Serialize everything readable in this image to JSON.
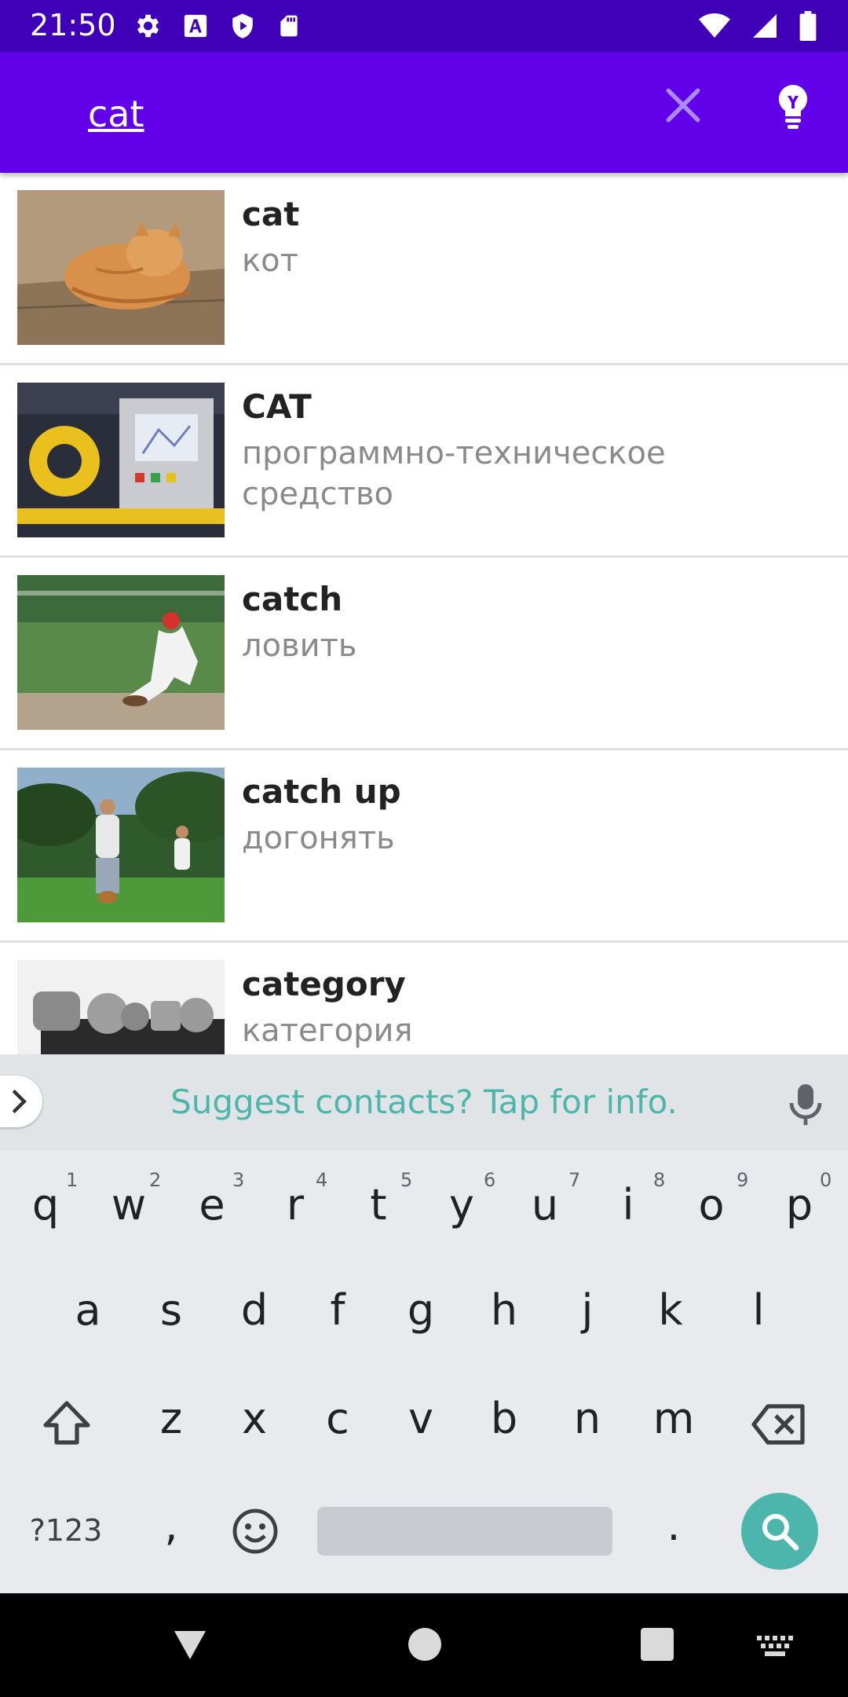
{
  "status_bar": {
    "time": "21:50",
    "left_icons": [
      "settings-icon",
      "font-a-icon",
      "play-protect-icon",
      "sd-card-icon"
    ],
    "right_icons": [
      "wifi-icon",
      "signal-icon",
      "battery-icon"
    ]
  },
  "search": {
    "query": "cat",
    "clear_icon": "close-icon",
    "tip_icon": "lightbulb-icon"
  },
  "results": [
    {
      "word": "cat",
      "translation": "кот",
      "image": "cat-photo"
    },
    {
      "word": "CAT",
      "translation": "программно-техническое средство",
      "image": "machine-photo"
    },
    {
      "word": "catch",
      "translation": "ловить",
      "image": "baseball-photo"
    },
    {
      "word": "catch up",
      "translation": "догонять",
      "image": "running-photo"
    },
    {
      "word": "category",
      "translation": "категория",
      "image": "objects-photo"
    }
  ],
  "keyboard": {
    "suggestion": "Suggest contacts? Tap for info.",
    "row1": [
      "q",
      "w",
      "e",
      "r",
      "t",
      "y",
      "u",
      "i",
      "o",
      "p"
    ],
    "row1_hints": [
      "1",
      "2",
      "3",
      "4",
      "5",
      "6",
      "7",
      "8",
      "9",
      "0"
    ],
    "row2": [
      "a",
      "s",
      "d",
      "f",
      "g",
      "h",
      "j",
      "k",
      "l"
    ],
    "row3": [
      "z",
      "x",
      "c",
      "v",
      "b",
      "n",
      "m"
    ],
    "symbols_label": "?123",
    "comma": ",",
    "period": ".",
    "colors": {
      "accent": "#4db6ac",
      "background": "#e8eaed"
    }
  },
  "colors": {
    "status_bar": "#4000b8",
    "app_bar": "#6200ea"
  }
}
